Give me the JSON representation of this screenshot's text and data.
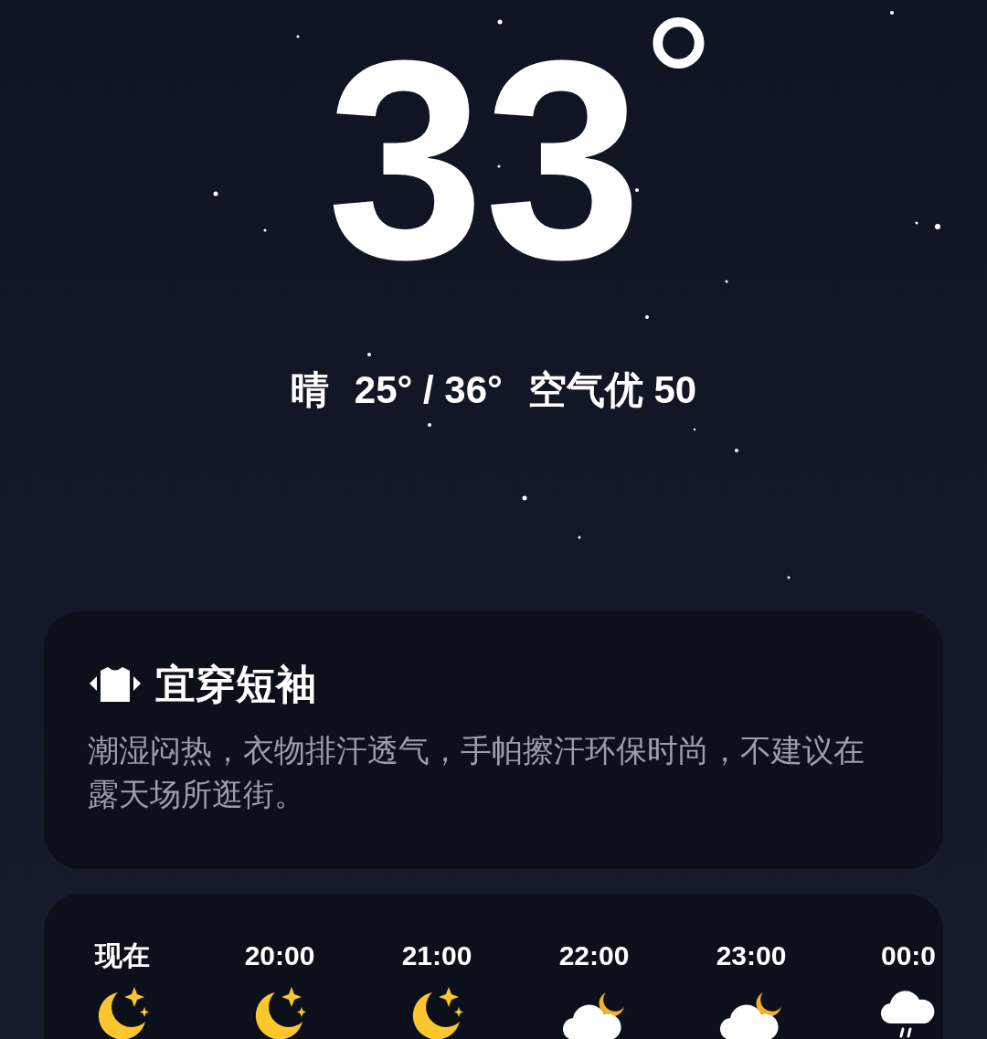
{
  "current": {
    "temperature": "33°",
    "condition": "晴",
    "range": "25° / 36°",
    "air_quality": "空气优 50"
  },
  "advice": {
    "title": "宜穿短袖",
    "text": "潮湿闷热，衣物排汗透气，手帕擦汗环保时尚，不建议在露天场所逛街。"
  },
  "hourly": [
    {
      "time": "现在",
      "kind": "moon"
    },
    {
      "time": "20:00",
      "kind": "moon"
    },
    {
      "time": "21:00",
      "kind": "moon"
    },
    {
      "time": "22:00",
      "kind": "cloud_moon"
    },
    {
      "time": "23:00",
      "kind": "cloud_moon"
    },
    {
      "time": "00:0",
      "kind": "rain"
    }
  ]
}
